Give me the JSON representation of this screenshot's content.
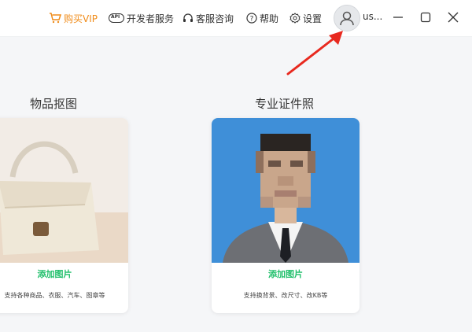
{
  "titlebar": {
    "vip_label": "购买VIP",
    "dev_label": "开发者服务",
    "dev_badge": "API",
    "support_label": "客服咨询",
    "help_label": "帮助",
    "settings_label": "设置",
    "username": "us..."
  },
  "sections": {
    "object_title": "物品抠图",
    "id_photo_title": "专业证件照"
  },
  "cards": {
    "object": {
      "add_label": "添加图片",
      "desc": "支持各种商品、衣服、汽车、图章等"
    },
    "id_photo": {
      "add_label": "添加图片",
      "desc": "支持换背景、改尺寸、改KB等"
    }
  },
  "colors": {
    "vip": "#f08c1a",
    "accent_green": "#1fbf6a",
    "id_bg_blue": "#3f8fd8",
    "arrow_red": "#e8291f"
  }
}
